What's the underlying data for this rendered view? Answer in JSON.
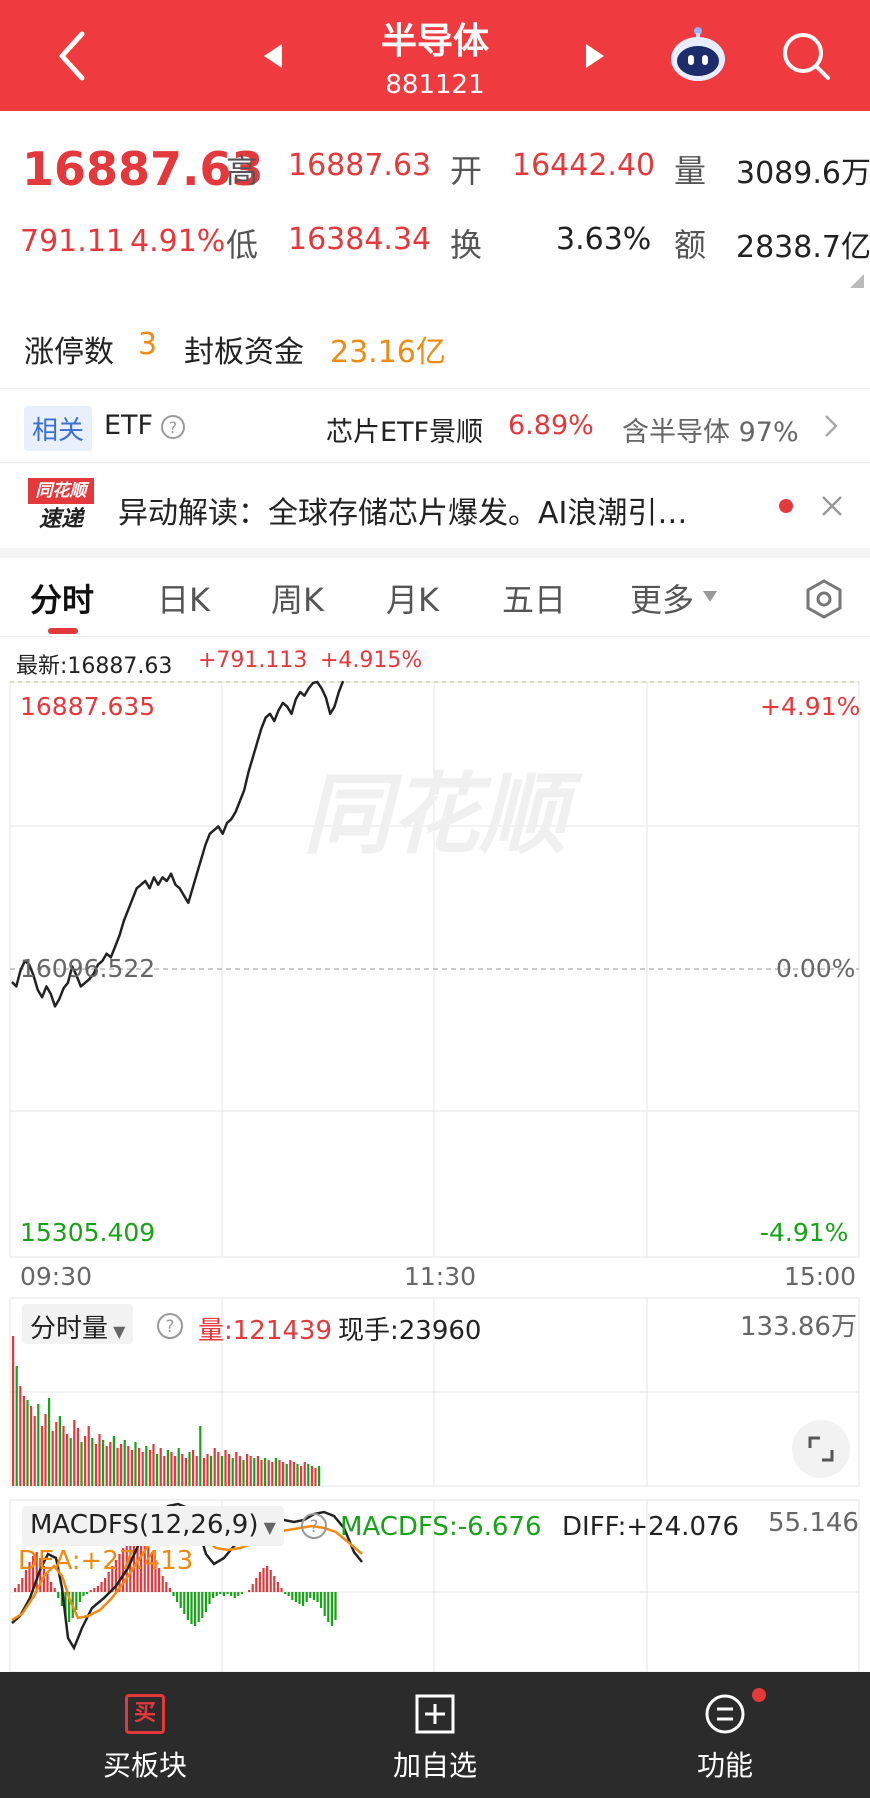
{
  "header": {
    "title": "半导体",
    "code": "881121"
  },
  "quote": {
    "price": "16887.63",
    "change": "791.11",
    "change_pct": "4.91%",
    "high_label": "高",
    "high": "16887.63",
    "low_label": "低",
    "low": "16384.34",
    "open_label": "开",
    "open": "16442.40",
    "turnover_label": "换",
    "turnover": "3.63%",
    "volume_label": "量",
    "volume": "3089.6万",
    "amount_label": "额",
    "amount": "2838.7亿"
  },
  "limit": {
    "count_label": "涨停数",
    "count": "3",
    "fund_label": "封板资金",
    "fund": "23.16亿"
  },
  "etf": {
    "tag": "相关",
    "label": "ETF",
    "name": "芯片ETF景顺",
    "pct": "6.89%",
    "contain": "含半导体 97%"
  },
  "news": {
    "logo_top": "同花顺",
    "logo_bottom": "速递",
    "text": "异动解读：全球存储芯片爆发。AI浪潮引…"
  },
  "tabs": [
    "分时",
    "日K",
    "周K",
    "月K",
    "五日",
    "更多"
  ],
  "chart": {
    "latest_label": "最新:16887.63",
    "latest_change": "+791.113",
    "latest_pct": "+4.915%",
    "top_value": "16887.635",
    "top_pct": "+4.91%",
    "mid_value": "16096.522",
    "mid_pct": "0.00%",
    "bottom_value": "15305.409",
    "bottom_pct": "-4.91%",
    "watermark": "同花顺",
    "time_labels": [
      "09:30",
      "11:30",
      "15:00"
    ],
    "price_series": [
      16062,
      16050,
      16095,
      16120,
      16110,
      16080,
      16040,
      16020,
      16050,
      16030,
      15995,
      16015,
      16045,
      16060,
      16105,
      16080,
      16050,
      16060,
      16070,
      16085,
      16110,
      16120,
      16140,
      16130,
      16160,
      16190,
      16230,
      16260,
      16290,
      16320,
      16330,
      16340,
      16320,
      16350,
      16330,
      16350,
      16340,
      16360,
      16330,
      16320,
      16300,
      16280,
      16320,
      16360,
      16400,
      16440,
      16470,
      16480,
      16490,
      16470,
      16500,
      16510,
      16530,
      16560,
      16590,
      16640,
      16680,
      16720,
      16760,
      16790,
      16800,
      16780,
      16810,
      16830,
      16820,
      16800,
      16840,
      16860,
      16850,
      16870,
      16885,
      16888,
      16870,
      16845,
      16800,
      16820,
      16860,
      16890
    ]
  },
  "volume": {
    "selector": "分时量",
    "amount": "量:121439",
    "hand": "现手:23960",
    "max": "133.86万"
  },
  "macd": {
    "selector": "MACDFS(12,26,9)",
    "macdfs": "MACDFS:-6.676",
    "diff": "DIFF:+24.076",
    "dea": "DEA:+27.413",
    "max": "55.146"
  },
  "colors": {
    "header": "#ef3b3f",
    "red": "#e4393c",
    "green": "#17a317",
    "orange": "#f08a10",
    "nav_bg": "#2b2b2b"
  },
  "bottom_nav": {
    "buy": "买板块",
    "buy_icon": "买",
    "add": "加自选",
    "func": "功能"
  }
}
